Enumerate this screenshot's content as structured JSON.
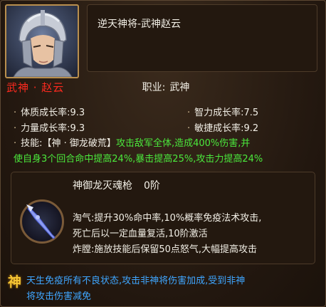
{
  "hero": {
    "name": "武神 · 赵云",
    "portrait_icon": "helmeted-warrior-portrait"
  },
  "title": "逆天神将-武神赵云",
  "job": {
    "label": "职业:",
    "value": "武神"
  },
  "stats": [
    {
      "label": "体质成长率:",
      "value": "9.3"
    },
    {
      "label": "智力成长率:",
      "value": "7.5"
    },
    {
      "label": "力量成长率:",
      "value": "9.3"
    },
    {
      "label": "敏捷成长率:",
      "value": "9.2"
    }
  ],
  "skill": {
    "label": "技能:",
    "name": "【神 · 御龙破荒】",
    "desc_line1": "攻击敌军全体,造成400%伤害,并",
    "desc_line2": "使自身3个回合命中提高24%,暴击提高25%,攻击力提高24%"
  },
  "weapon": {
    "name": "神御龙灭魂枪",
    "level": "0阶",
    "icon": "spear-icon",
    "line1": "淘气:提升30%命中率,10%概率免疫法术攻击,",
    "line2": "死亡后以一定血量复活,10阶激活",
    "line3": "炸膛:施放技能后保留50点怒气,大幅提高攻击"
  },
  "bonus": {
    "icon_glyph": "神",
    "line1": "天生免疫所有不良状态,攻击非神将伤害加成,受到非神",
    "line2": "将攻击伤害减免"
  },
  "colors": {
    "hero_name": "#ff2a1f",
    "skill_text": "#4be83c",
    "bonus_text": "#3fa6ff",
    "frame_gold": "#b98f4e"
  }
}
